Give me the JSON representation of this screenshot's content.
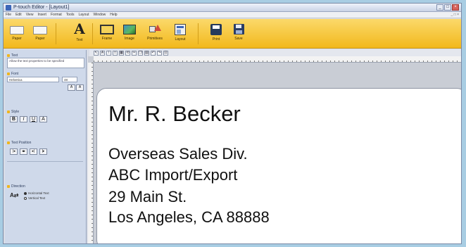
{
  "window": {
    "title": "P-touch Editor - [Layout1]"
  },
  "menu": [
    "File",
    "Edit",
    "View",
    "Insert",
    "Format",
    "Tools",
    "Layout",
    "Window",
    "Help"
  ],
  "ribbon": {
    "buttons": [
      {
        "label": "Paper",
        "icon": "tape-icon"
      },
      {
        "label": "Paper",
        "icon": "tape-icon"
      },
      {
        "label": "Text",
        "icon": "text-icon"
      },
      {
        "label": "Frame",
        "icon": "frame-icon"
      },
      {
        "label": "Image",
        "icon": "image-icon"
      },
      {
        "label": "Primitives",
        "icon": "shapes-icon"
      },
      {
        "label": "Layout",
        "icon": "layout-icon"
      },
      {
        "label": "Print",
        "icon": "printer-icon"
      },
      {
        "label": "Save",
        "icon": "save-icon"
      }
    ],
    "colors": {
      "top": "#fbd96a",
      "bottom": "#f2b81c"
    }
  },
  "properties": {
    "text_section": "Text",
    "hint": "Allow the text properties to be specified",
    "font_section": "Font",
    "font_value": "Helvetica",
    "font_size": "48",
    "style_section": "Style",
    "style_buttons": [
      "B",
      "I",
      "U",
      "A"
    ],
    "position_section": "Text Position",
    "direction_section": "Direction",
    "direction_options": [
      "Horizontal Text",
      "Vertical Text"
    ]
  },
  "label": {
    "lines": [
      "Mr. R. Becker",
      "Overseas Sales Div.",
      "ABC Import/Export",
      "29 Main St.",
      "Los Angeles, CA 88888"
    ]
  }
}
